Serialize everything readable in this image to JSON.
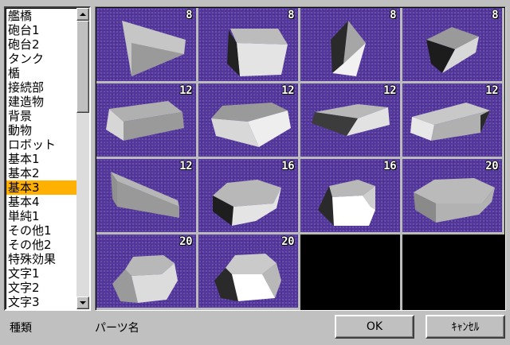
{
  "category_list": {
    "items": [
      "艦橋",
      "砲台1",
      "砲台2",
      "タンク",
      "楯",
      "接続部",
      "建造物",
      "背景",
      "動物",
      "ロボット",
      "基本1",
      "基本2",
      "基本3",
      "基本4",
      "単純1",
      "その他1",
      "その他2",
      "特殊効果",
      "文字1",
      "文字2",
      "文字3"
    ],
    "selected": "基本3"
  },
  "parts": [
    {
      "count": "8",
      "shape": "wedge-left"
    },
    {
      "count": "8",
      "shape": "wedge-trapezoid"
    },
    {
      "count": "8",
      "shape": "pyramid-tall"
    },
    {
      "count": "8",
      "shape": "wedge-box"
    },
    {
      "count": "12",
      "shape": "flat-slab"
    },
    {
      "count": "12",
      "shape": "beveled-slab"
    },
    {
      "count": "12",
      "shape": "ramp-slab"
    },
    {
      "count": "12",
      "shape": "cut-slab"
    },
    {
      "count": "12",
      "shape": "thin-wall"
    },
    {
      "count": "16",
      "shape": "hexagon-prism"
    },
    {
      "count": "16",
      "shape": "frustum-trapezoid"
    },
    {
      "count": "20",
      "shape": "hexagon-prism-wide"
    },
    {
      "count": "20",
      "shape": "hex-frustum"
    },
    {
      "count": "20",
      "shape": "hex-frustum-bright"
    }
  ],
  "footer": {
    "kind_label": "種類",
    "part_name_label": "パーツ名",
    "ok_label": "OK",
    "cancel_label": "ｷｬﾝｾﾙ"
  },
  "colors": {
    "tile_background": "#54379c",
    "selected_item": "#ffb000"
  }
}
